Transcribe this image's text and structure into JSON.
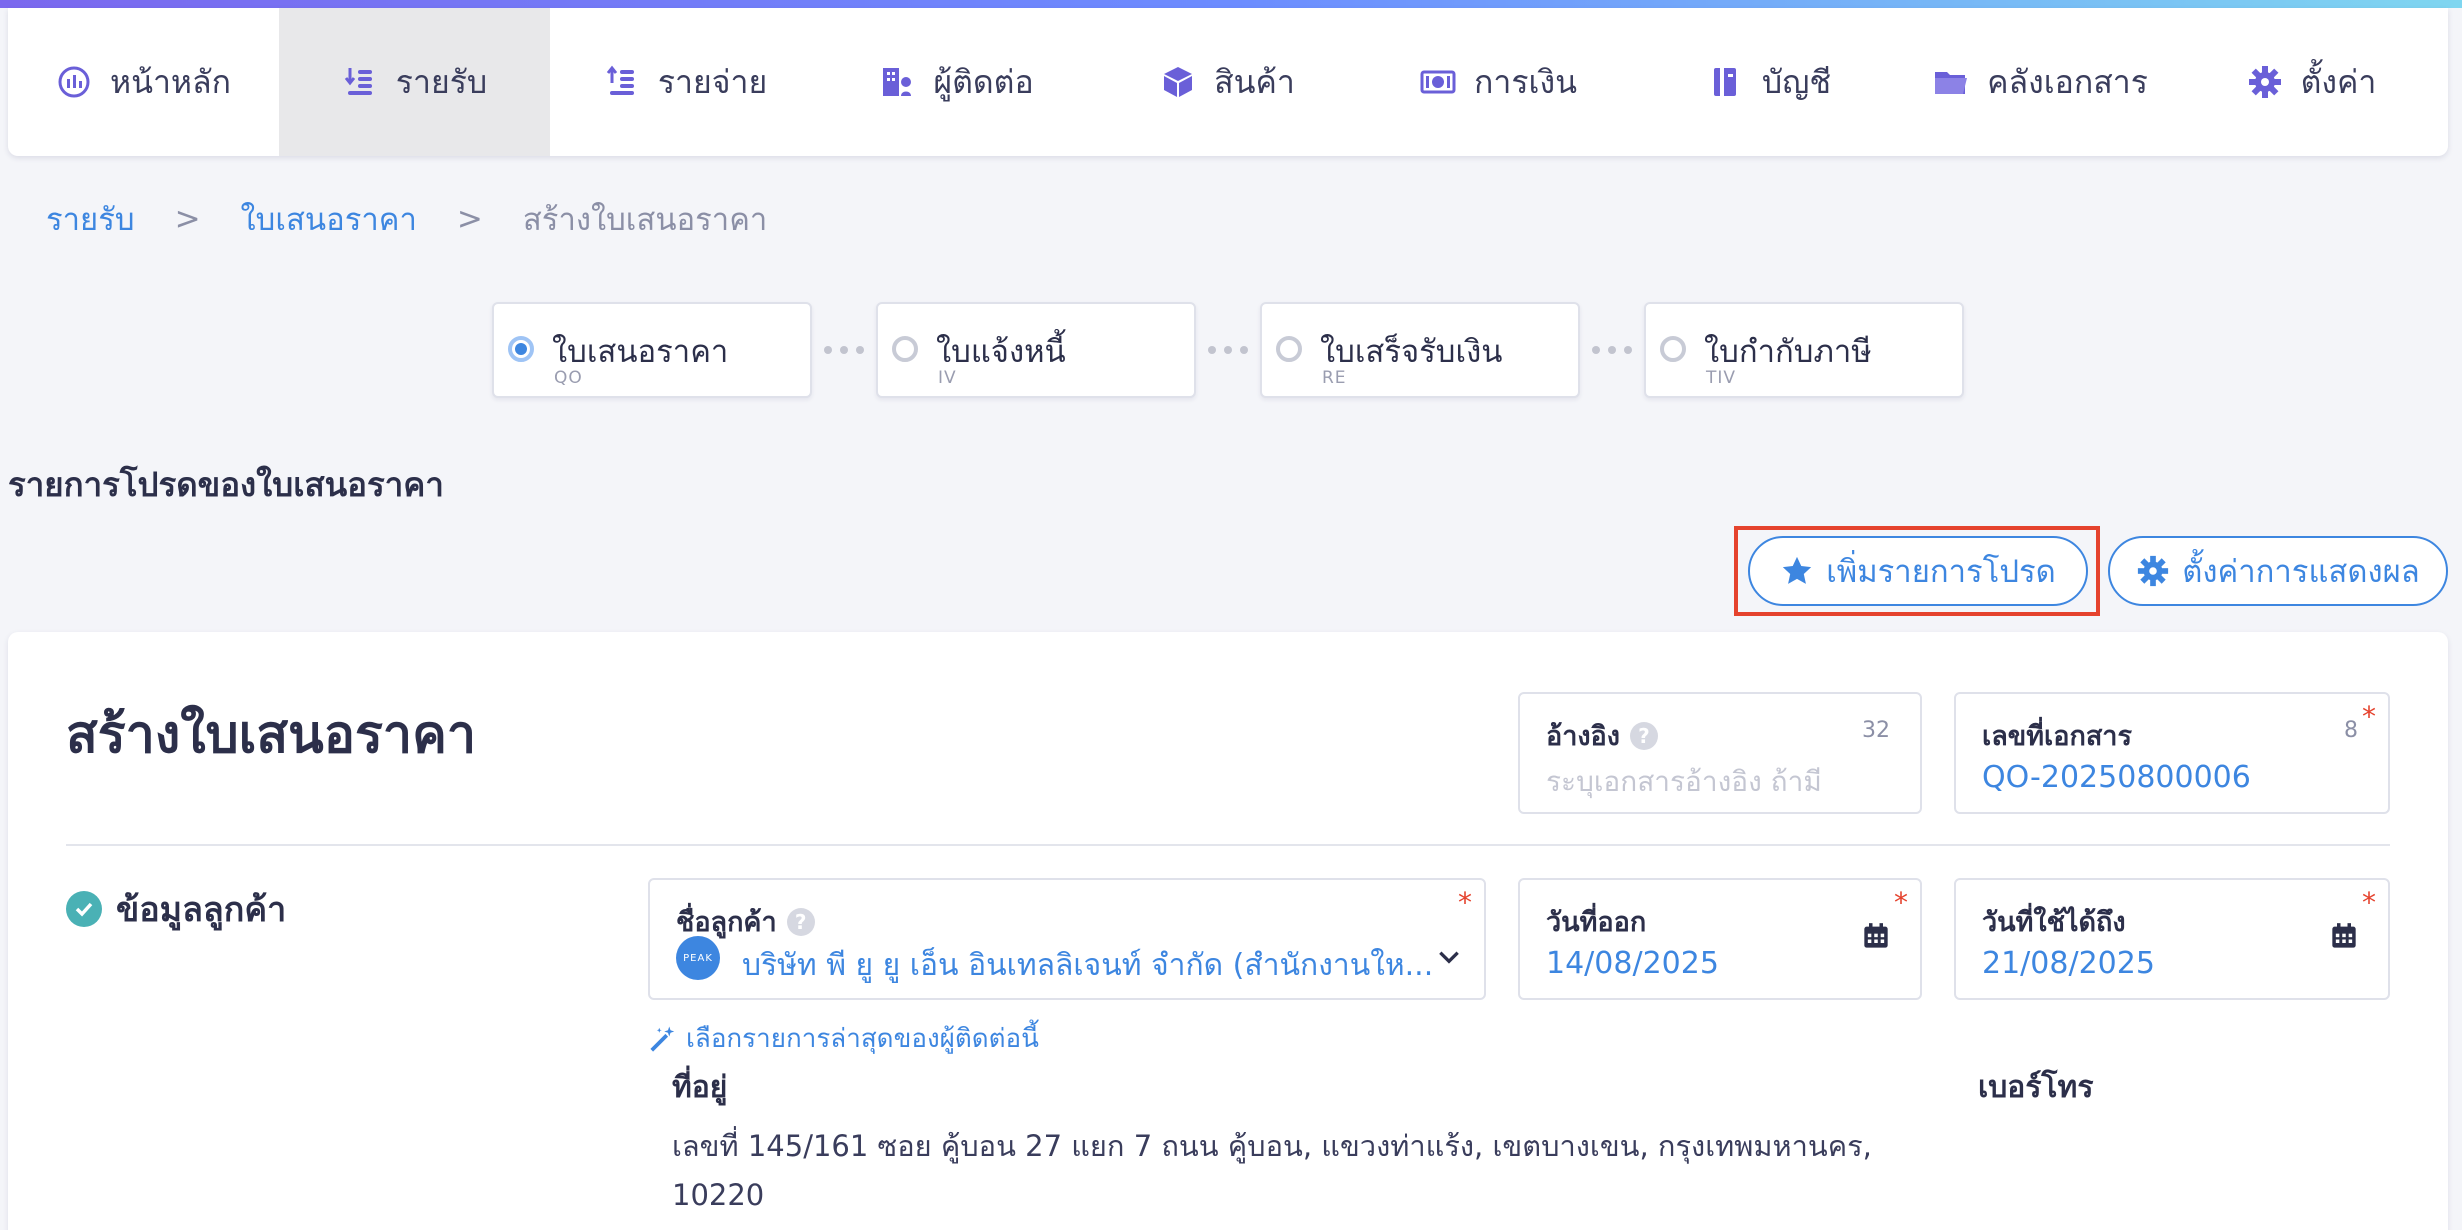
{
  "nav": {
    "items": [
      {
        "label": "หน้าหลัก",
        "icon": "chart-icon"
      },
      {
        "label": "รายรับ",
        "icon": "income-icon",
        "active": true
      },
      {
        "label": "รายจ่าย",
        "icon": "expense-icon"
      },
      {
        "label": "ผู้ติดต่อ",
        "icon": "building-icon"
      },
      {
        "label": "สินค้า",
        "icon": "box-icon"
      },
      {
        "label": "การเงิน",
        "icon": "money-icon"
      },
      {
        "label": "บัญชี",
        "icon": "ledger-icon"
      },
      {
        "label": "คลังเอกสาร",
        "icon": "folder-icon"
      },
      {
        "label": "ตั้งค่า",
        "icon": "gear-icon"
      }
    ]
  },
  "breadcrumb": {
    "items": [
      "รายรับ",
      "ใบเสนอราคา",
      "สร้างใบเสนอราคา"
    ],
    "separator": ">"
  },
  "steps": [
    {
      "title": "ใบเสนอราคา",
      "code": "QO",
      "active": true
    },
    {
      "title": "ใบแจ้งหนี้",
      "code": "IV"
    },
    {
      "title": "ใบเสร็จรับเงิน",
      "code": "RE"
    },
    {
      "title": "ใบกำกับภาษี",
      "code": "TIV"
    }
  ],
  "favorites": {
    "title": "รายการโปรดของใบเสนอราคา",
    "add_label": "เพิ่มรายการโปรด",
    "display_label": "ตั้งค่าการแสดงผล"
  },
  "form": {
    "title": "สร้างใบเสนอราคา",
    "reference": {
      "label": "อ้างอิง",
      "placeholder": "ระบุเอกสารอ้างอิง ถ้ามี",
      "count": "32"
    },
    "doc_number": {
      "label": "เลขที่เอกสาร",
      "value": "QO-20250800006",
      "count": "8"
    },
    "customer_section": "ข้อมูลลูกค้า",
    "customer": {
      "label": "ชื่อลูกค้า",
      "logo": "PEAK",
      "value": "บริษัท พี ยู ยู เอ็น อินเทลลิเจนท์ จำกัด (สำนักงานให..."
    },
    "issue_date": {
      "label": "วันที่ออก",
      "value": "14/08/2025"
    },
    "valid_until": {
      "label": "วันที่ใช้ได้ถึง",
      "value": "21/08/2025"
    },
    "recent_link": "เลือกรายการล่าสุดของผู้ติดต่อนี้",
    "address_label": "ที่อยู่",
    "phone_label": "เบอร์โทร",
    "address_value": "เลขที่ 145/161 ซอย คู้บอน 27 แยก 7 ถนน คู้บอน, แขวงท่าแร้ง, เขตบางเขน, กรุงเทพมหานคร, 10220",
    "required_mark": "*",
    "help_mark": "?"
  },
  "colors": {
    "accent": "#3d86e0",
    "required": "#e5432e",
    "highlight": "#e5432e",
    "check": "#4ab1b5"
  }
}
